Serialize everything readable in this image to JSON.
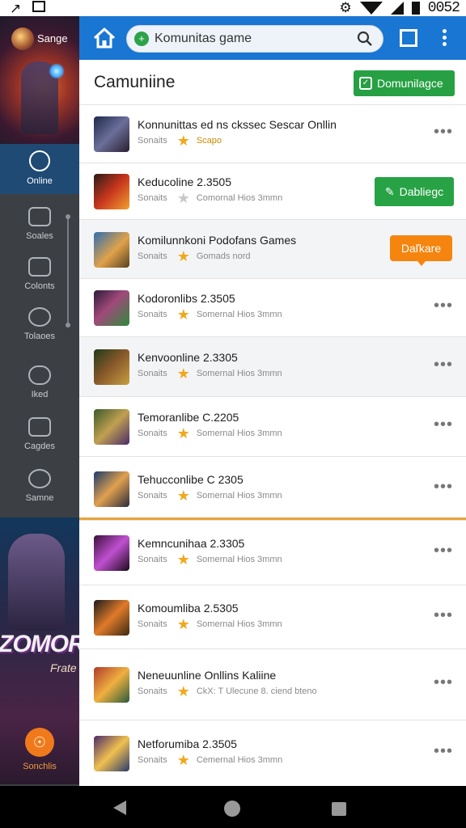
{
  "status_bar": {
    "time": "0052"
  },
  "sidebar": {
    "profile_name": "Sange",
    "items": [
      {
        "label": "Online",
        "icon": "online-icon",
        "active": true
      },
      {
        "label": "Soales",
        "icon": "sales-icon"
      },
      {
        "label": "Colonts",
        "icon": "contacts-icon"
      },
      {
        "label": "Tolaoes",
        "icon": "tools-icon"
      },
      {
        "label": "Iked",
        "icon": "cloud-icon"
      },
      {
        "label": "Cagdes",
        "icon": "cards-icon"
      },
      {
        "label": "Samne",
        "icon": "heart-icon"
      }
    ],
    "banner_logo": "ZOMORK",
    "banner_sub": "Frate",
    "bottom_label": "Sonchlis"
  },
  "topbar": {
    "search_value": "Komunitas game",
    "search_badge": "+"
  },
  "main": {
    "section_title": "Camuniine",
    "header_button": "Domunilagce",
    "rows": [
      {
        "title": "Konnunittas ed ns ckssec Sescar Onllin",
        "sub": "Sonaits",
        "desc": "Scapo",
        "star": "gold",
        "desc_highlight": true,
        "action": "kebab"
      },
      {
        "title": "Keducoline 2.3505",
        "sub": "Sonaits",
        "desc": "Comornal Hios 3mmn",
        "star": "grey",
        "action": "green",
        "action_label": "Dabliegc"
      },
      {
        "title": "Komilunnkoni Podofans Games",
        "sub": "Sonaits",
        "desc": "Gomads nord",
        "star": "gold",
        "action": "orange",
        "action_label": "Daľkare"
      },
      {
        "title": "Kodoronlibs 2.3505",
        "sub": "Sonaits",
        "desc": "Somernal Hios 3mmn",
        "star": "gold",
        "action": "kebab"
      },
      {
        "title": "Kenvoonline 2.3305",
        "sub": "Sonaits",
        "desc": "Somernal Hios 3mmn",
        "star": "gold",
        "action": "kebab"
      },
      {
        "title": "Temoranlibe C.2205",
        "sub": "Sonaits",
        "desc": "Somernal Hios 3mmn",
        "star": "gold",
        "action": "kebab"
      },
      {
        "title": "Tehucconlibe C 2305",
        "sub": "Sonaits",
        "desc": "Somernal Hios 3mmn",
        "star": "gold",
        "action": "kebab"
      },
      {
        "title": "Kemncunihaa 2.3305",
        "sub": "Sonaits",
        "desc": "Somernal Hios 3mmn",
        "star": "gold",
        "action": "kebab"
      },
      {
        "title": "Komoumliba 2.5305",
        "sub": "Sonaits",
        "desc": "Somernal Hios 3mmn",
        "star": "gold",
        "action": "kebab"
      },
      {
        "title": "Neneuunline Onllins Kaliine",
        "sub": "Sonaits",
        "desc": "CkX: T Ulecune 8. ciend bteno",
        "star": "gold",
        "action": "kebab"
      },
      {
        "title": "Netforumiba 2.3505",
        "sub": "Sonaits",
        "desc": "Cemernal Hios 3mmn",
        "star": "gold",
        "action": "kebab"
      }
    ],
    "kebab_glyph": "•••"
  },
  "colors": {
    "topbar": "#1976d2",
    "sidebar": "#3c3f44",
    "sidebar_active": "#1f4a74",
    "green": "#26a043",
    "orange": "#f5850f",
    "star": "#f0a81c",
    "divider": "#e7a33a"
  }
}
